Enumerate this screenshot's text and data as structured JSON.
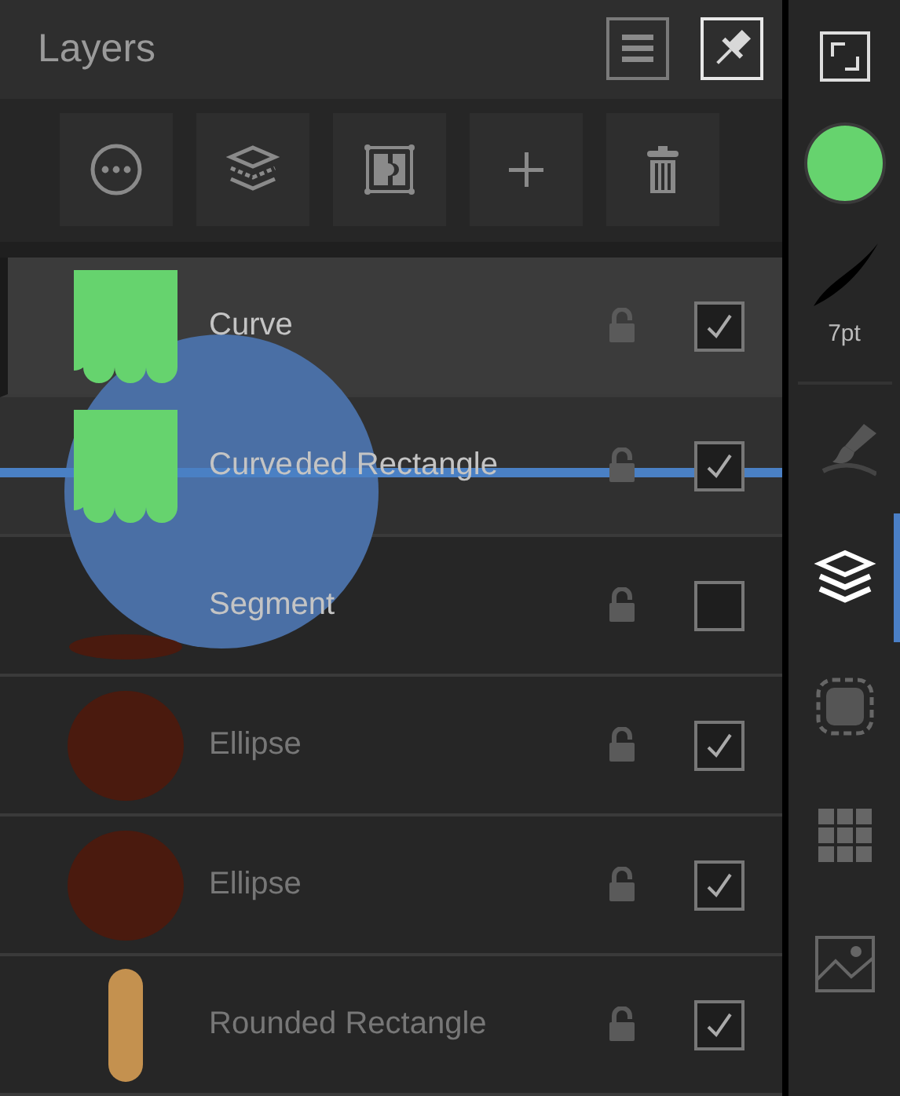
{
  "panel": {
    "title": "Layers"
  },
  "header_buttons": [
    {
      "kind": "menu",
      "selected": false
    },
    {
      "kind": "pin",
      "selected": true
    }
  ],
  "toolbar": [
    {
      "kind": "more"
    },
    {
      "kind": "layers"
    },
    {
      "kind": "mask"
    },
    {
      "kind": "add"
    },
    {
      "kind": "delete"
    }
  ],
  "layers": [
    {
      "name": "Curve",
      "kind": "curve",
      "color": "#66d36e",
      "locked": false,
      "visible": true,
      "selected": true
    },
    {
      "name": "ded Rectangle",
      "kind": "hidden",
      "locked": false,
      "visible": true,
      "selected": false,
      "drag_over": true
    },
    {
      "name": "Segment",
      "kind": "segment",
      "color": "#4a1a0e",
      "locked": false,
      "visible": false,
      "selected": false
    },
    {
      "name": "Ellipse",
      "kind": "ellipse",
      "color": "#4a1a0e",
      "locked": false,
      "visible": true,
      "selected": false
    },
    {
      "name": "Ellipse",
      "kind": "ellipse",
      "color": "#4a1a0e",
      "locked": false,
      "visible": true,
      "selected": false
    },
    {
      "name": "Rounded Rectangle",
      "kind": "pill",
      "color": "#c4914f",
      "locked": false,
      "visible": true,
      "selected": false
    }
  ],
  "drag": {
    "label": "Curve",
    "kind": "curve",
    "color": "#66d36e"
  },
  "sidebar": {
    "color": "#66d36e",
    "stroke_size": "7pt",
    "tools": [
      {
        "kind": "brush",
        "selected": false
      },
      {
        "kind": "layers",
        "selected": true
      },
      {
        "kind": "selection",
        "selected": false
      },
      {
        "kind": "grid",
        "selected": false
      },
      {
        "kind": "image",
        "selected": false
      }
    ]
  }
}
